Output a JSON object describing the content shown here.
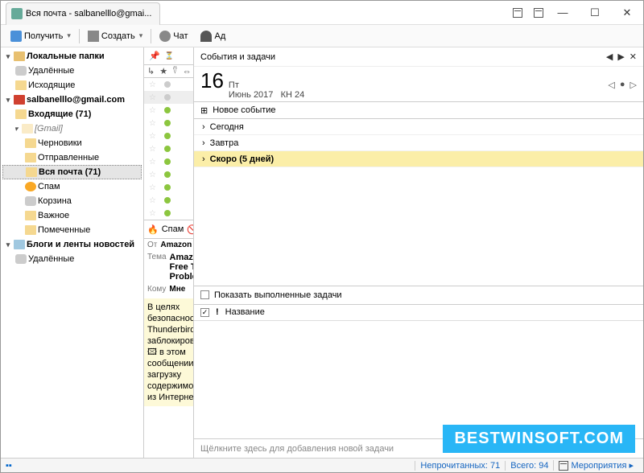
{
  "window": {
    "title": "Вся почта - salbanelllo@gmai..."
  },
  "titlebar_buttons": {
    "min": "—",
    "max": "☐",
    "close": "✕"
  },
  "toolbar": {
    "receive": "Получить",
    "create": "Создать",
    "chat": "Чат",
    "address": "Ад"
  },
  "sidebar": {
    "local": "Локальные папки",
    "deleted": "Удалённые",
    "outgoing": "Исходящие",
    "account": "salbanelllo@gmail.com",
    "inbox": "Входящие (71)",
    "gmail": "[Gmail]",
    "drafts": "Черновики",
    "sent": "Отправленные",
    "allmail": "Вся почта (71)",
    "spam": "Спам",
    "trash": "Корзина",
    "important": "Важное",
    "starred": "Помеченные",
    "feeds": "Блоги и ленты новостей",
    "feeds_deleted": "Удалённые"
  },
  "center": {
    "spam_btn": "Спам",
    "from_lbl": "От",
    "from_val": "Amazon Pr",
    "subject_lbl": "Тема",
    "subject_val_1": "Amazon Pr",
    "subject_val_2": "Free Trial",
    "subject_val_3": "Problem",
    "to_lbl": "Кому",
    "to_val": "Мне",
    "body_1": "В целях",
    "body_2": "безопасност",
    "body_3": "Thunderbird",
    "body_4": "заблокирова",
    "body_5": "в этом",
    "body_6": "сообщении",
    "body_7": "загрузку",
    "body_8": "содержимог",
    "body_9": "из Интернета"
  },
  "events": {
    "title": "События и задачи",
    "daynum": "16",
    "dayname": "Пт",
    "month": "Июнь 2017",
    "week": "КН 24",
    "new_event": "Новое событие",
    "today": "Сегодня",
    "tomorrow": "Завтра",
    "soon": "Скоро (5 дней)",
    "show_done": "Показать выполненные задачи",
    "col_title": "Название",
    "add_task": "Щёлкните здесь для добавления новой задачи"
  },
  "statusbar": {
    "unread": "Непрочитанных: 71",
    "total": "Всего: 94",
    "events_lbl": "Мероприятия"
  },
  "watermark": "BESTWINSOFT.COM"
}
